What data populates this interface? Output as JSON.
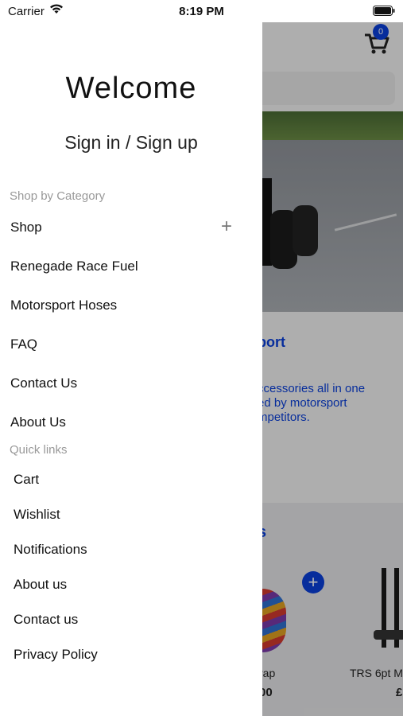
{
  "status_bar": {
    "carrier": "Carrier",
    "time": "8:19 PM"
  },
  "drawer": {
    "welcome": "Welcome",
    "sign_in": "Sign in / Sign up",
    "category_heading": "Shop by Category",
    "categories": [
      {
        "label": "Shop",
        "expandable": true,
        "expand_icon": "plus-icon"
      },
      {
        "label": "Renegade Race Fuel"
      },
      {
        "label": "Motorsport Hoses"
      },
      {
        "label": "FAQ"
      },
      {
        "label": "Contact Us"
      },
      {
        "label": "About Us"
      }
    ],
    "quick_links_heading": "Quick links",
    "quick_links": [
      {
        "label": "Cart"
      },
      {
        "label": "Wishlist"
      },
      {
        "label": "Notifications"
      },
      {
        "label": "About us"
      },
      {
        "label": "Contact us"
      },
      {
        "label": "Privacy Policy"
      }
    ]
  },
  "background_app": {
    "cart_count": "0",
    "heading_fragment": "port",
    "text_fragments": [
      "ccessories all in one",
      "ed by motorsport",
      "mpetitors."
    ],
    "section_title_fragment": "s",
    "product_1": {
      "name": "rap",
      "price": "00"
    },
    "product_2": {
      "name": "TRS 6pt M",
      "price": "£"
    },
    "add_button": "+",
    "accent_color": "#0a3fd8"
  }
}
